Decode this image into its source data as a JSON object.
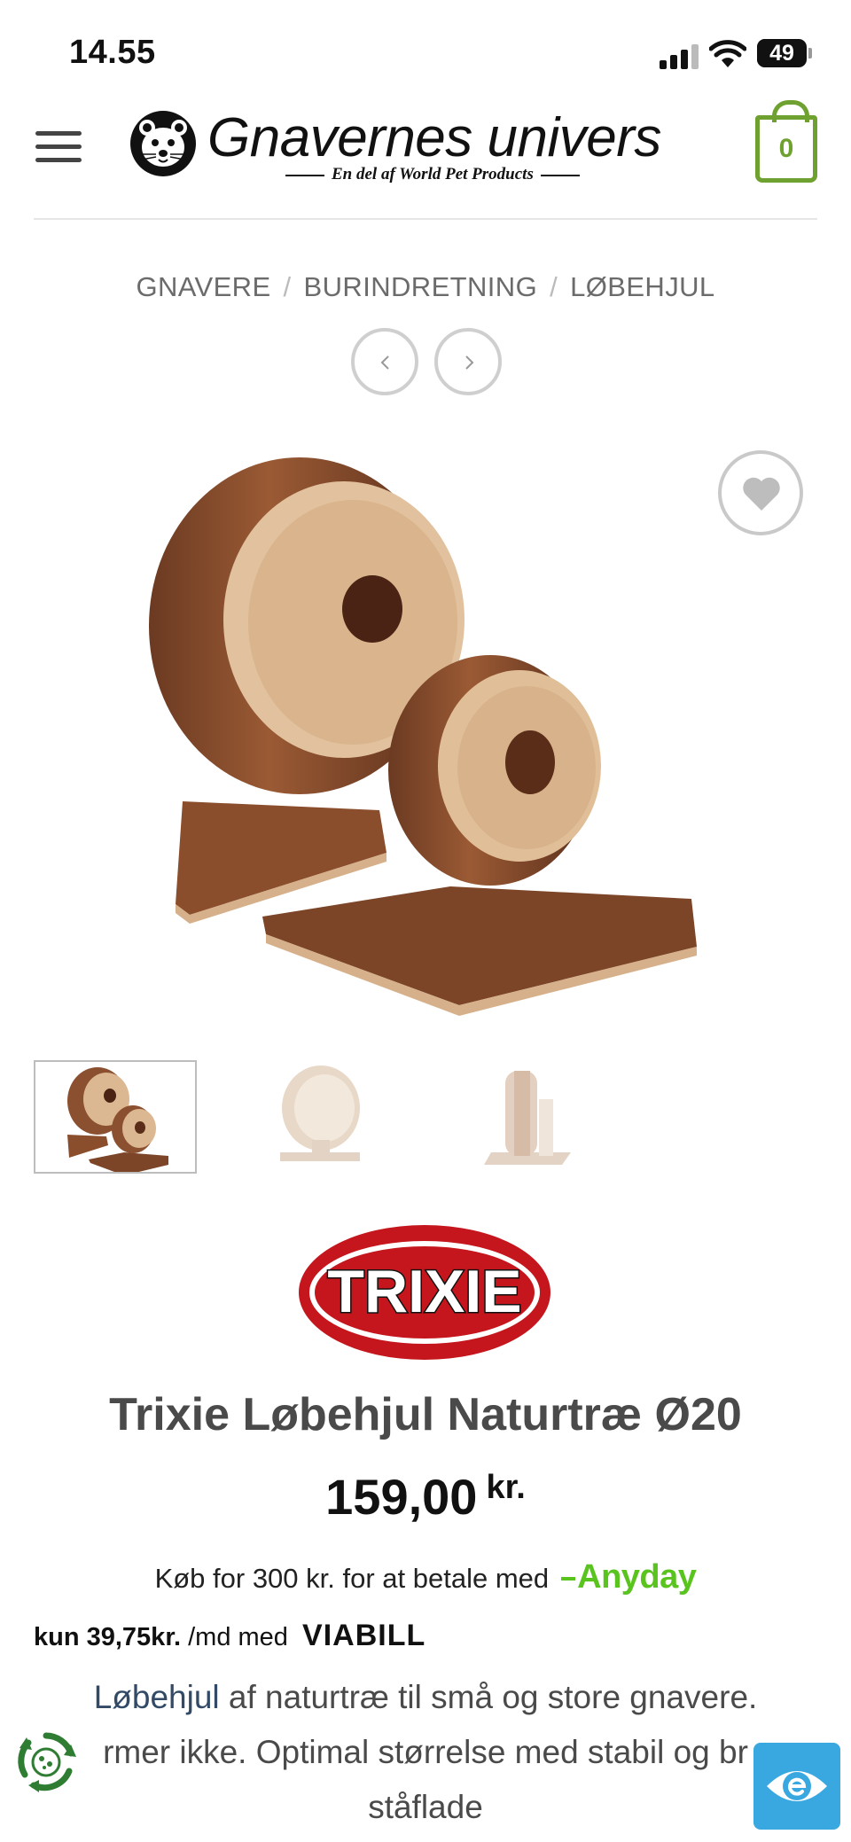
{
  "status_bar": {
    "time": "14.55",
    "battery": "49",
    "icons": [
      "signal-icon",
      "wifi-icon",
      "battery-icon"
    ]
  },
  "header": {
    "menu_icon": "hamburger-menu-icon",
    "logo_title": "Gnavernes univers",
    "logo_subtitle": "En del af World Pet Products",
    "cart_count": "0",
    "accent_color": "#6ea12f"
  },
  "breadcrumb": {
    "items": [
      "GNAVERE",
      "BURINDRETNING",
      "LØBEHJUL"
    ],
    "separator": "/"
  },
  "product": {
    "brand": "TRIXIE",
    "title": "Trixie Løbehjul Naturtræ Ø20",
    "price": "159,00",
    "currency": "kr.",
    "thumbnails_count": 3,
    "active_thumbnail": 1
  },
  "payment": {
    "anyday_text": "Køb for 300 kr. for at betale med",
    "anyday_logo": "Anyday",
    "viabill_amount": "kun 39,75kr.",
    "viabill_text": "/md med",
    "viabill_logo": "VIABILL"
  },
  "description": {
    "link": "Løbehjul",
    "line1_rest": " af naturtræ til små og store gnavere.",
    "line2": "rmer ikke. Optimal størrelse med stabil og br",
    "line3": "ståflade"
  },
  "floating": {
    "cookie_icon": "cookie-consent-icon",
    "accessibility_icon": "accessibility-eye-icon"
  }
}
